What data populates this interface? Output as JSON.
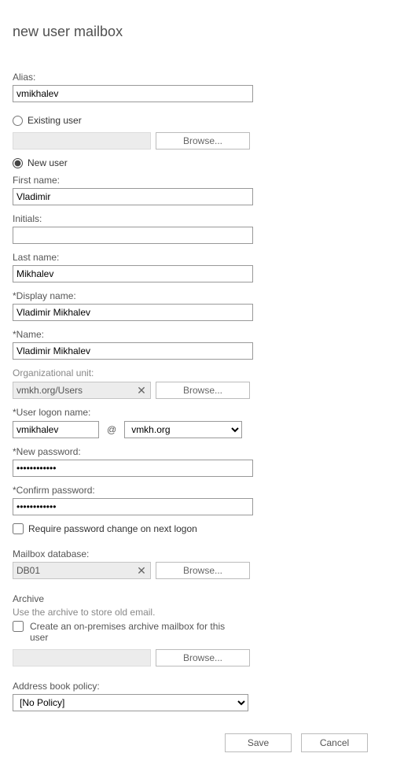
{
  "title": "new user mailbox",
  "alias": {
    "label": "Alias:",
    "value": "vmikhalev"
  },
  "existingUser": {
    "label": "Existing user",
    "browse": "Browse...",
    "selected": false
  },
  "newUser": {
    "label": "New user",
    "selected": true
  },
  "firstName": {
    "label": "First name:",
    "value": "Vladimir"
  },
  "initials": {
    "label": "Initials:",
    "value": ""
  },
  "lastName": {
    "label": "Last name:",
    "value": "Mikhalev"
  },
  "displayName": {
    "label": "*Display name:",
    "value": "Vladimir Mikhalev"
  },
  "name": {
    "label": "*Name:",
    "value": "Vladimir Mikhalev"
  },
  "ou": {
    "label": "Organizational unit:",
    "value": "vmkh.org/Users",
    "browse": "Browse..."
  },
  "logon": {
    "label": "*User logon name:",
    "value": "vmikhalev",
    "at": "@",
    "domain": "vmkh.org"
  },
  "newPassword": {
    "label": "*New password:",
    "value": "••••••••••••"
  },
  "confirmPassword": {
    "label": "*Confirm password:",
    "value": "••••••••••••"
  },
  "requireChange": {
    "label": "Require password change on next logon",
    "checked": false
  },
  "mailboxDb": {
    "label": "Mailbox database:",
    "value": "DB01",
    "browse": "Browse..."
  },
  "archive": {
    "heading": "Archive",
    "hint": "Use the archive to store old email.",
    "checkbox": "Create an on-premises archive mailbox for this user",
    "checked": false,
    "browse": "Browse..."
  },
  "abp": {
    "label": "Address book policy:",
    "value": "[No Policy]"
  },
  "buttons": {
    "save": "Save",
    "cancel": "Cancel"
  }
}
